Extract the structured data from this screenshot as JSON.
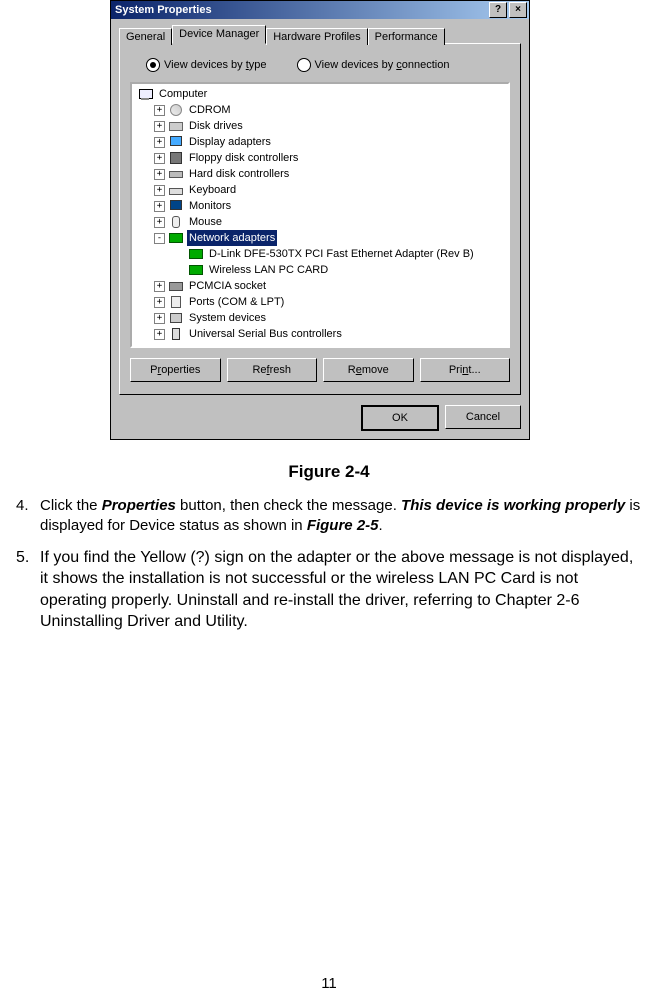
{
  "dialog": {
    "title": "System Properties",
    "help_label": "?",
    "close_label": "×",
    "tabs": {
      "general": "General",
      "device_manager": "Device Manager",
      "hardware_profiles": "Hardware Profiles",
      "performance": "Performance"
    },
    "radios": {
      "by_type": "View devices by type",
      "by_type_uchar": "t",
      "by_conn": "View devices by connection",
      "by_conn_uchar": "c"
    },
    "tree": {
      "root": "Computer",
      "items": [
        {
          "label": "CDROM",
          "icon": "cd"
        },
        {
          "label": "Disk drives",
          "icon": "disk"
        },
        {
          "label": "Display adapters",
          "icon": "display"
        },
        {
          "label": "Floppy disk controllers",
          "icon": "floppy"
        },
        {
          "label": "Hard disk controllers",
          "icon": "hdd"
        },
        {
          "label": "Keyboard",
          "icon": "kb"
        },
        {
          "label": "Monitors",
          "icon": "monitor"
        },
        {
          "label": "Mouse",
          "icon": "mouse"
        }
      ],
      "network": {
        "label": "Network adapters",
        "children": [
          "D-Link DFE-530TX PCI Fast Ethernet Adapter (Rev B)",
          "Wireless LAN PC CARD"
        ]
      },
      "items2": [
        {
          "label": "PCMCIA socket",
          "icon": "pcmcia"
        },
        {
          "label": "Ports (COM & LPT)",
          "icon": "ports"
        },
        {
          "label": "System devices",
          "icon": "sys"
        },
        {
          "label": "Universal Serial Bus controllers",
          "icon": "usb"
        }
      ]
    },
    "buttons": {
      "properties": "Properties",
      "properties_u": "r",
      "refresh": "Refresh",
      "refresh_u": "f",
      "remove": "Remove",
      "remove_u": "e",
      "print": "Print...",
      "print_u": "N"
    },
    "footer": {
      "ok": "OK",
      "cancel": "Cancel"
    }
  },
  "doc": {
    "figure_caption": "Figure 2-4",
    "step4_num": "4.",
    "step4_a": "Click the ",
    "step4_b": "Properties",
    "step4_c": " button, then check the message. ",
    "step4_d": "This device is working properly",
    "step4_e": " is displayed for Device status as shown in ",
    "step4_f": "Figure 2-5",
    "step4_g": ".",
    "step5_num": "5.",
    "step5": "If you find the Yellow (?) sign on the adapter or the above message is not displayed, it shows the installation is not successful or the wireless LAN PC Card is not operating properly. Uninstall and re-install the driver, referring to Chapter 2-6 Uninstalling Driver and Utility.",
    "page_number": "11"
  }
}
